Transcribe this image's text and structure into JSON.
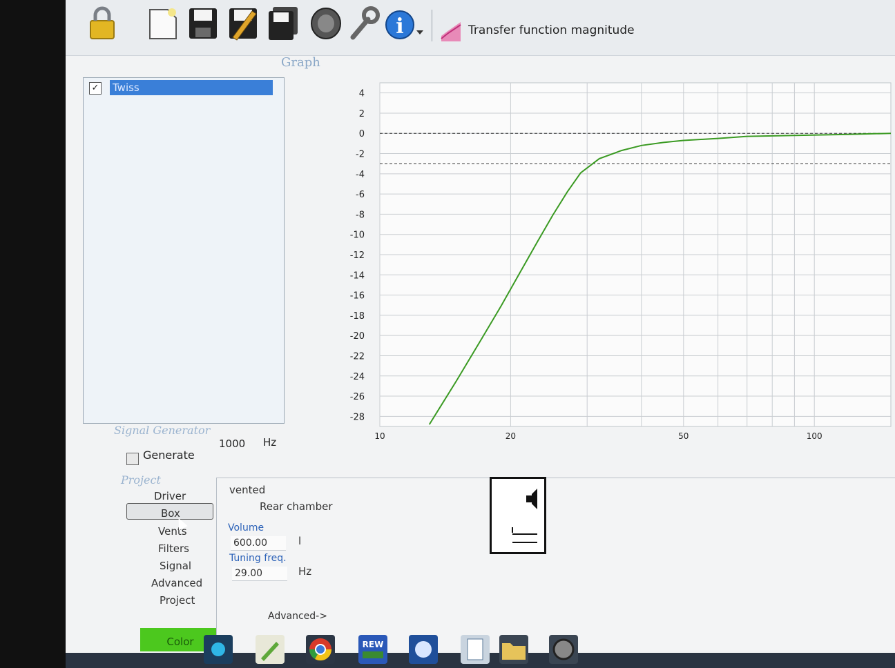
{
  "toolbar": {
    "icons": [
      "lock-icon",
      "new-document-icon",
      "save-icon",
      "save-edit-icon",
      "save-all-icon",
      "speaker-icon",
      "wrench-icon",
      "info-icon",
      "chevron-down-icon"
    ],
    "graph_type_label": "Transfer function magnitude"
  },
  "graph_panel": {
    "title": "Graph",
    "list_items": [
      {
        "label": "Twiss",
        "checked": true
      }
    ]
  },
  "chart_data": {
    "type": "line",
    "xscale": "log",
    "xlim": [
      10,
      150
    ],
    "ylim": [
      -29,
      5
    ],
    "y_ticks": [
      4,
      2,
      0,
      -2,
      -4,
      -6,
      -8,
      -10,
      -12,
      -14,
      -16,
      -18,
      -20,
      -22,
      -24,
      -26,
      -28
    ],
    "x_ticks": [
      10,
      20,
      50,
      100
    ],
    "reference_lines": [
      0,
      -3
    ],
    "grid": true,
    "series": [
      {
        "color": "#3a9a22",
        "x": [
          13,
          15,
          17,
          19,
          21,
          23,
          25,
          27,
          29,
          32,
          36,
          40,
          45,
          50,
          60,
          70,
          90,
          120,
          150
        ],
        "y": [
          -28.8,
          -24.5,
          -20.6,
          -17.1,
          -13.8,
          -10.8,
          -8.1,
          -5.8,
          -3.9,
          -2.5,
          -1.7,
          -1.2,
          -0.9,
          -0.7,
          -0.5,
          -0.3,
          -0.2,
          -0.1,
          0
        ]
      }
    ]
  },
  "signal_generator": {
    "title": "Signal Generator",
    "generate_label": "Generate",
    "frequency": "1000",
    "unit": "Hz"
  },
  "project_nav": {
    "title": "Project",
    "items": [
      "Driver",
      "Box",
      "Vents",
      "Filters",
      "Signal",
      "Advanced",
      "Project"
    ],
    "selected": "Box",
    "color_button": "Color",
    "color_button_bg": "#4cc81e"
  },
  "box_panel": {
    "type": "vented",
    "chamber": "Rear chamber",
    "volume_label": "Volume",
    "volume_value": "600.00",
    "volume_unit": "l",
    "tuning_label": "Tuning freq.",
    "tuning_value": "29.00",
    "tuning_unit": "Hz",
    "advanced_link": "Advanced->"
  },
  "taskbar": {
    "icons": [
      "network-icon",
      "paint-icon",
      "chrome-icon",
      "rew-icon",
      "dsp-icon",
      "spreadsheet-icon",
      "folder-icon",
      "speaker-app-icon"
    ],
    "labels": {
      "rew": "REW"
    }
  }
}
